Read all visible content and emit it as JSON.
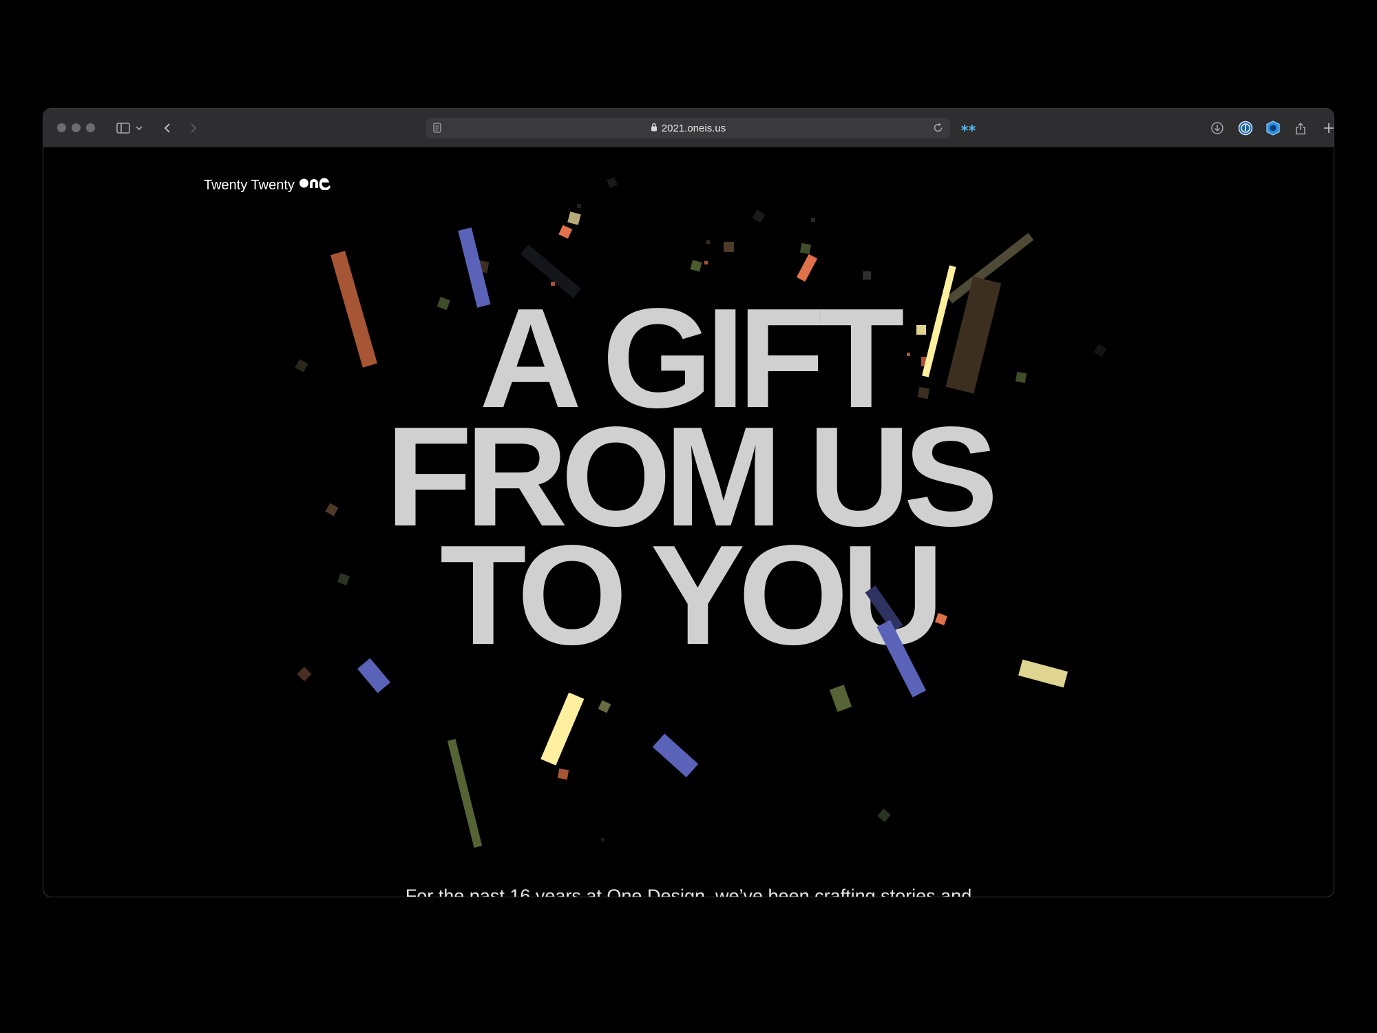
{
  "browser": {
    "url": "2021.oneis.us",
    "icons": [
      "sidebar-icon",
      "chevron-down-icon",
      "back-icon",
      "forward-icon",
      "reader-icon",
      "lock-icon",
      "reload-icon",
      "extension-icon",
      "download-icon",
      "password-manager-icon",
      "shield-icon",
      "share-icon",
      "new-tab-icon",
      "tab-overview-icon"
    ]
  },
  "page": {
    "logo_text": "Twenty Twenty",
    "logo_mark": "one",
    "headline": [
      "A GIFT",
      "FROM US",
      "TO YOU"
    ],
    "intro": "For the past 16 years at One Design, we’ve been crafting stories and"
  },
  "colors": {
    "background": "#000000",
    "headline": "#d0d0d0",
    "confetti": [
      "#a65535",
      "#5a63b8",
      "#fff0a0",
      "#dfd590",
      "#556335",
      "#4f4a35",
      "#3d2f1f",
      "#e0724b",
      "#2e3260"
    ]
  }
}
